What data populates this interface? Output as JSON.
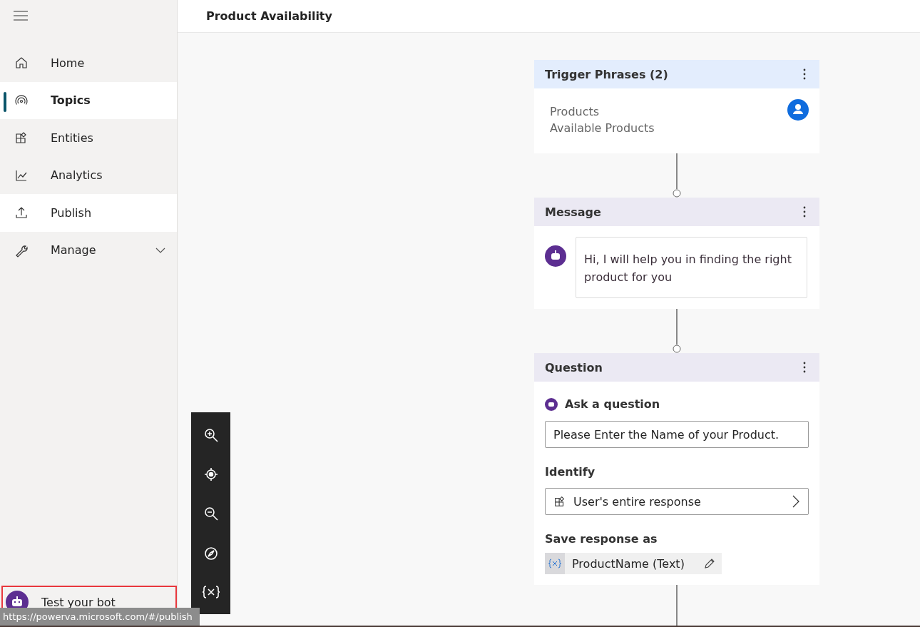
{
  "sidebar": {
    "items": [
      {
        "label": "Home",
        "selected": false,
        "hovered": false
      },
      {
        "label": "Topics",
        "selected": true,
        "hovered": false
      },
      {
        "label": "Entities",
        "selected": false,
        "hovered": false
      },
      {
        "label": "Analytics",
        "selected": false,
        "hovered": false
      },
      {
        "label": "Publish",
        "selected": false,
        "hovered": true
      },
      {
        "label": "Manage",
        "selected": false,
        "hovered": false,
        "expanded": false
      }
    ],
    "test_bot": {
      "label": "Test your bot",
      "highlighted": true
    }
  },
  "header": {
    "title": "Product Availability"
  },
  "nodes": [
    {
      "kind": "trigger",
      "title": "Trigger Phrases (2)",
      "phrases": [
        "Products",
        "Available Products"
      ]
    },
    {
      "kind": "message",
      "title": "Message",
      "text": "Hi, I will help you in finding the right product for you"
    },
    {
      "kind": "question",
      "title": "Question",
      "ask_label": "Ask a question",
      "question": "Please Enter the Name of your Product.",
      "identify_label": "Identify",
      "identify_value": "User's entire response",
      "save_label": "Save response as",
      "variable": "ProductName (Text)"
    }
  ],
  "status_url": "https://powerva.microsoft.com/#/publish"
}
